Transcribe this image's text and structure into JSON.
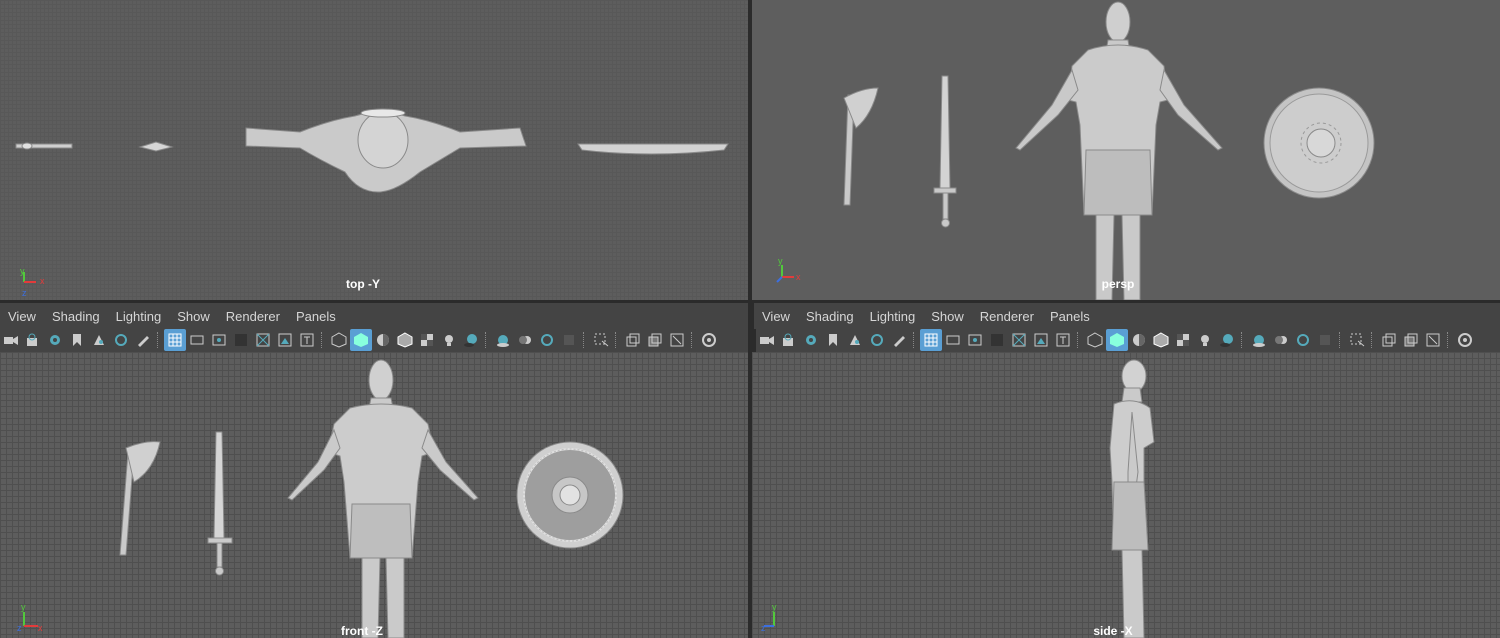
{
  "viewports": {
    "top": {
      "label": "top -Y"
    },
    "persp": {
      "label": "persp"
    },
    "front": {
      "label": "front -Z"
    },
    "side": {
      "label": "side -X"
    }
  },
  "panel_menu": {
    "items": [
      "View",
      "Shading",
      "Lighting",
      "Show",
      "Renderer",
      "Panels"
    ]
  },
  "axis": {
    "x": "x",
    "y": "y",
    "z": "z"
  },
  "colors": {
    "viewport_bg": "#5d5d5d",
    "toolbar_bg": "#444444",
    "active_icon": "#5a9fd4",
    "axis_x": "#e33b3b",
    "axis_y": "#52c93c",
    "axis_z": "#3c6fe0"
  }
}
